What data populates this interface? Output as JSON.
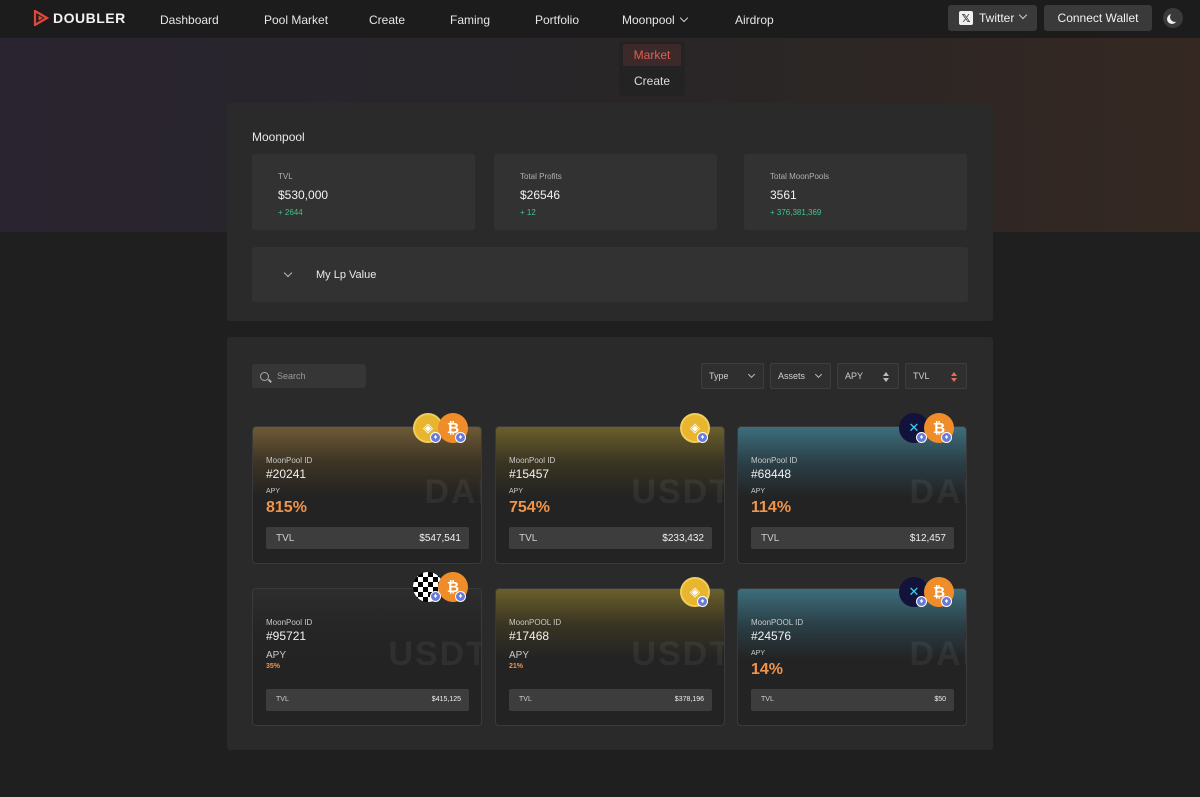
{
  "app": {
    "logo_text": "DOUBLER"
  },
  "nav": {
    "items": [
      "Dashboard",
      "Pool Market",
      "Create",
      "Faming",
      "Portfolio",
      "Moonpool",
      "Airdrop"
    ],
    "twitter_label": "Twitter",
    "connect_label": "Connect Wallet"
  },
  "dropdown": {
    "items": [
      "Market",
      "Create"
    ],
    "active": "Market"
  },
  "summary": {
    "title": "Moonpool",
    "stats": [
      {
        "label": "TVL",
        "value": "$530,000",
        "delta": "+ 2644"
      },
      {
        "label": "Total Profits",
        "value": "$26546",
        "delta": "+ 12"
      },
      {
        "label": "Total MoonPools",
        "value": "3561",
        "delta": "+ 376,381,369"
      }
    ],
    "lp_label": "My Lp Value"
  },
  "filters": {
    "search_placeholder": "Search",
    "type": "Type",
    "assets": "Assets",
    "apy": "APY",
    "tvl": "TVL"
  },
  "pools": [
    {
      "id_label": "MoonPool ID",
      "id": "#20241",
      "apy_label": "APY",
      "apy": "815%",
      "tvl_label": "TVL",
      "tvl": "$547,541",
      "watermark": "DAI",
      "tokens": [
        "bnb-icon",
        "btc-icon"
      ],
      "theme": "brown"
    },
    {
      "id_label": "MoonPool ID",
      "id": "#15457",
      "apy_label": "APY",
      "apy": "754%",
      "tvl_label": "TVL",
      "tvl": "$233,432",
      "watermark": "USDT",
      "tokens": [
        "bnb-icon"
      ],
      "theme": "olive"
    },
    {
      "id_label": "MoonPool ID",
      "id": "#68448",
      "apy_label": "APY",
      "apy": "114%",
      "tvl_label": "TVL",
      "tvl": "$12,457",
      "watermark": "DAI",
      "tokens": [
        "snx-icon",
        "btc-icon"
      ],
      "theme": "teal"
    },
    {
      "id_label": "MoonPool ID",
      "id": "#95721",
      "apy_label": "APY",
      "apy": "35%",
      "tvl_label": "TVL",
      "tvl": "$415,125",
      "watermark": "USDT",
      "tokens": [
        "checker-icon",
        "btc-icon"
      ],
      "theme": "dark"
    },
    {
      "id_label": "MoonPOOL ID",
      "id": "#17468",
      "apy_label": "APY",
      "apy": "21%",
      "tvl_label": "TVL",
      "tvl": "$378,196",
      "watermark": "USDT",
      "tokens": [
        "bnb-icon"
      ],
      "theme": "olive"
    },
    {
      "id_label": "MoonPOOL ID",
      "id": "#24576",
      "apy_label": "APY",
      "apy": "14%",
      "tvl_label": "TVL",
      "tvl": "$50",
      "watermark": "DAI",
      "tokens": [
        "snx-icon",
        "btc-icon"
      ],
      "theme": "teal"
    }
  ],
  "colors": {
    "accent": "#e55d4c",
    "apy": "#f0944a",
    "delta": "#3fc38a"
  }
}
